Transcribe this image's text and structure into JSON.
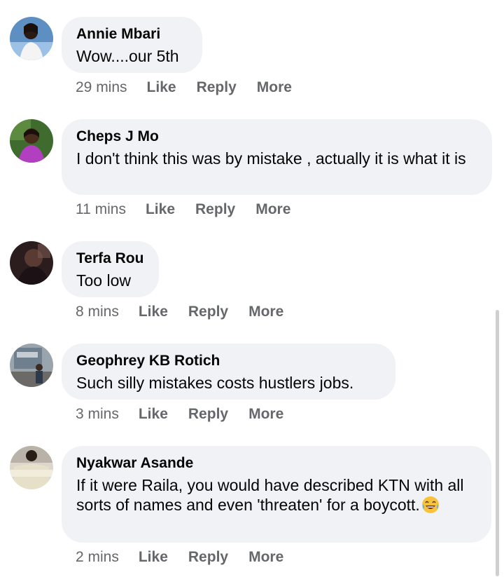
{
  "comments": [
    {
      "author": "Annie Mbari",
      "text": "Wow....our 5th",
      "time": "29 mins",
      "like": "Like",
      "reply": "Reply",
      "more": "More",
      "avatar_icon": "profile-photo"
    },
    {
      "author": "Cheps J Mo",
      "text": "I don't think this was by mistake , actually it is what it is",
      "time": "11 mins",
      "like": "Like",
      "reply": "Reply",
      "more": "More",
      "avatar_icon": "profile-photo"
    },
    {
      "author": "Terfa Rou",
      "text": "Too low",
      "time": "8 mins",
      "like": "Like",
      "reply": "Reply",
      "more": "More",
      "avatar_icon": "profile-photo"
    },
    {
      "author": "Geophrey KB Rotich",
      "text": "Such silly mistakes costs hustlers jobs.",
      "time": "3 mins",
      "like": "Like",
      "reply": "Reply",
      "more": "More",
      "avatar_icon": "profile-photo"
    },
    {
      "author": "Nyakwar Asande",
      "text": "If it were Raila, you would have described KTN with all sorts of names and even 'threaten' for a boycott.",
      "time": "2 mins",
      "like": "Like",
      "reply": "Reply",
      "more": "More",
      "avatar_icon": "profile-photo",
      "trailing_emoji": "laughing-tears-emoji"
    }
  ],
  "colors": {
    "bubble": "#f0f2f5",
    "secondary_text": "#65676b",
    "primary_text": "#050505"
  }
}
